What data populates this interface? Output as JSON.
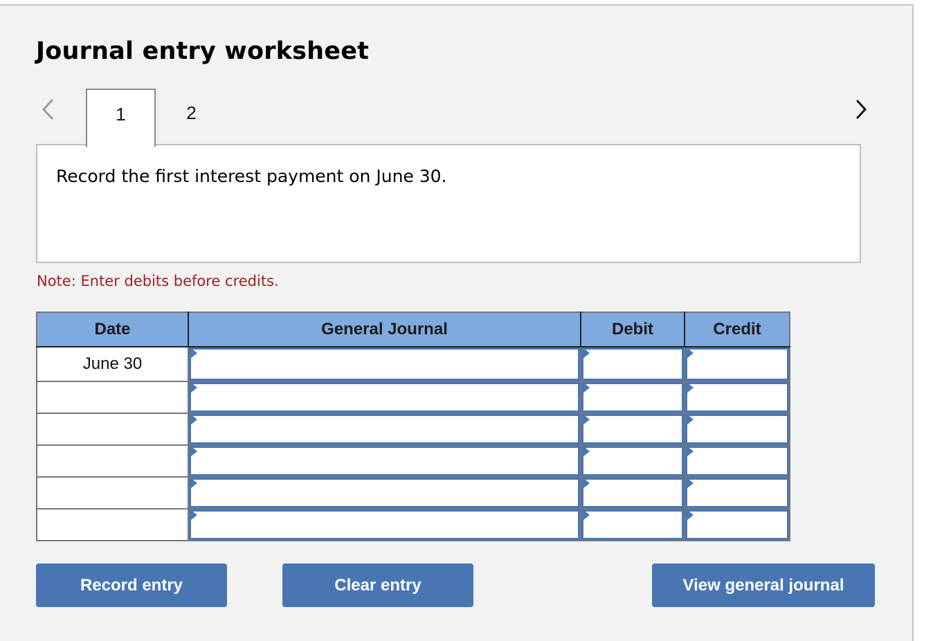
{
  "worksheet": {
    "title": "Journal entry worksheet",
    "nav": {
      "prev_icon": "chevron-left-icon",
      "next_icon": "chevron-right-icon",
      "prev_enabled": false,
      "next_enabled": true
    },
    "tabs": [
      {
        "label": "1",
        "active": true
      },
      {
        "label": "2",
        "active": false
      }
    ],
    "prompt": "Record the first interest payment on June 30.",
    "note": "Note: Enter debits before credits."
  },
  "journal": {
    "columns": [
      "Date",
      "General Journal",
      "Debit",
      "Credit"
    ],
    "rows": [
      {
        "date": "June 30",
        "account": "",
        "debit": "",
        "credit": ""
      },
      {
        "date": "",
        "account": "",
        "debit": "",
        "credit": ""
      },
      {
        "date": "",
        "account": "",
        "debit": "",
        "credit": ""
      },
      {
        "date": "",
        "account": "",
        "debit": "",
        "credit": ""
      },
      {
        "date": "",
        "account": "",
        "debit": "",
        "credit": ""
      },
      {
        "date": "",
        "account": "",
        "debit": "",
        "credit": ""
      }
    ]
  },
  "buttons": {
    "record": "Record entry",
    "clear": "Clear entry",
    "view": "View general journal"
  },
  "colors": {
    "header_bg": "#7faadf",
    "input_border": "#4a77b6",
    "button_bg": "#4876b3",
    "note_text": "#a11f1f",
    "panel_bg": "#f2f2f2"
  }
}
